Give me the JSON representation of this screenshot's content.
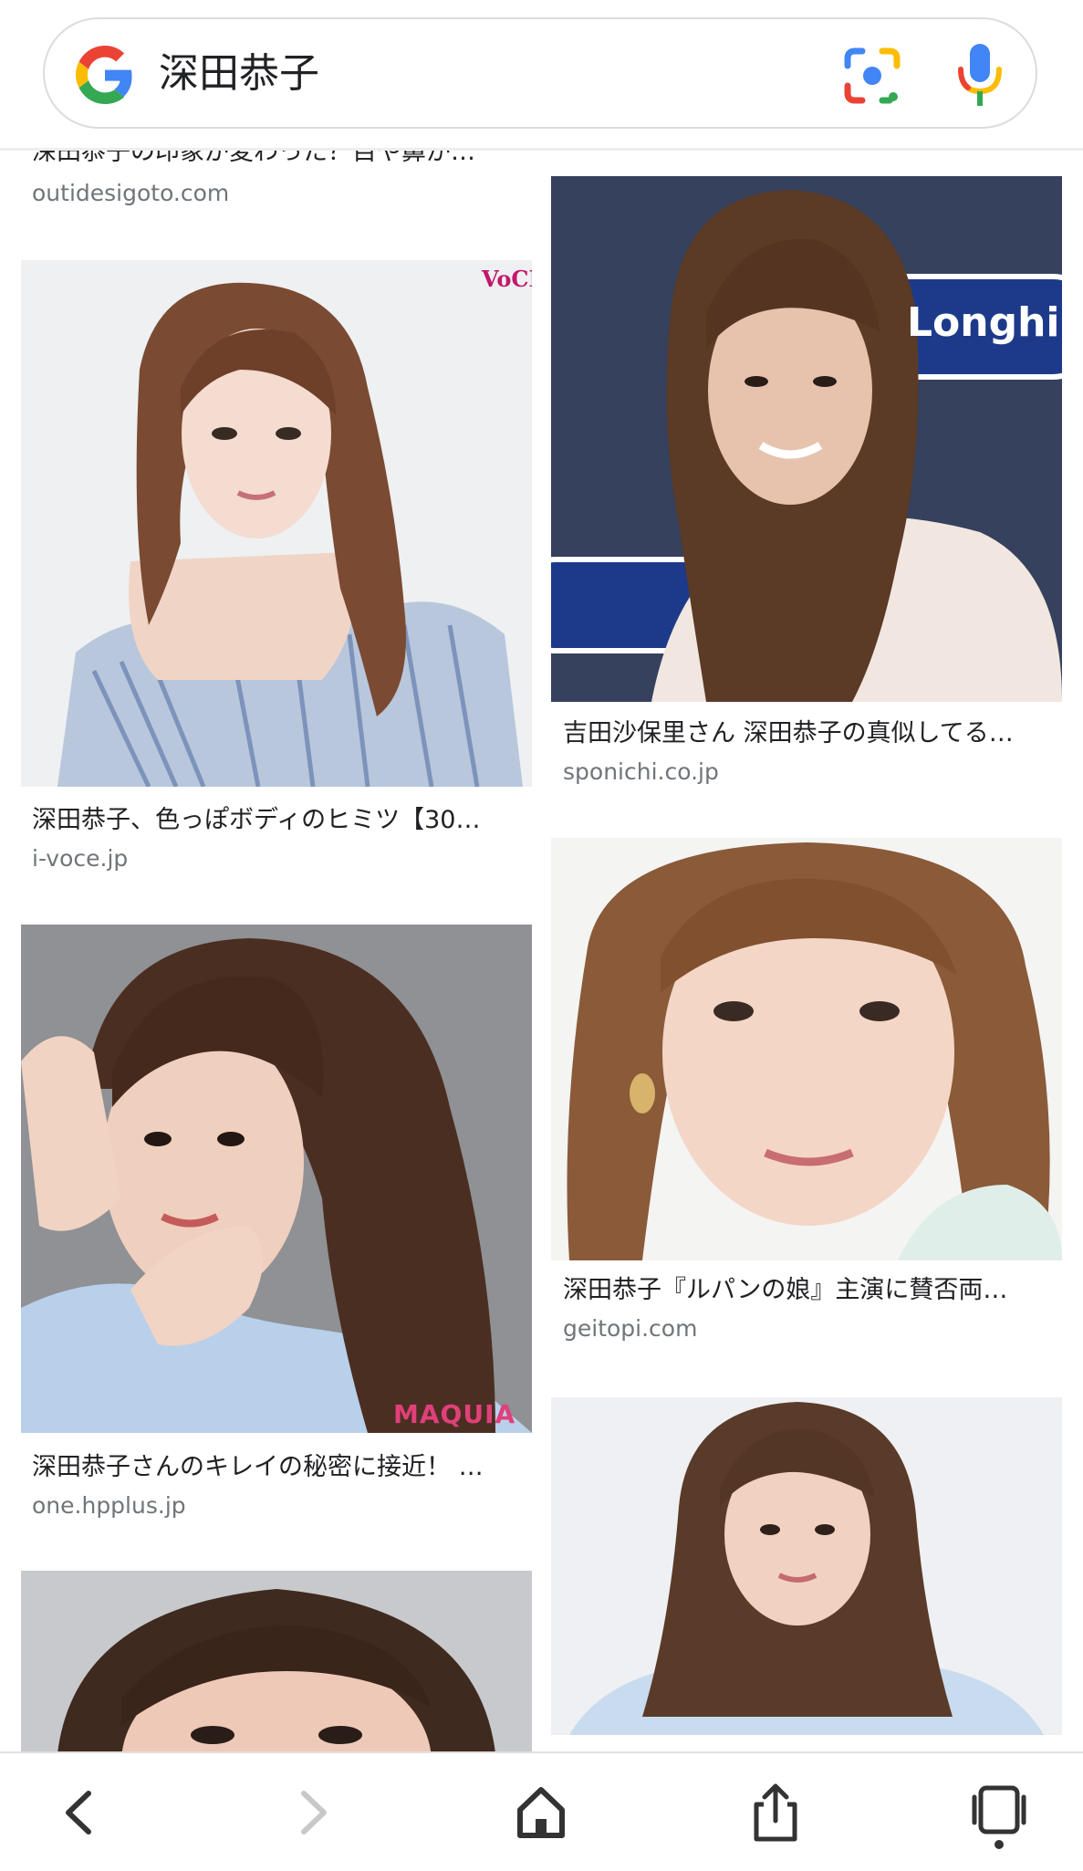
{
  "search": {
    "query": "深田恭子"
  },
  "results": [
    {
      "caption": "深田恭子の印象が変わった？目や鼻が…",
      "source": "outidesigoto.com"
    },
    {
      "caption": "深田恭子、色っぽボディのヒミツ【30…",
      "source": "i-voce.jp",
      "watermark": "VoCE"
    },
    {
      "caption": "吉田沙保里さん 深田恭子の真似してる…",
      "source": "sponichi.co.jp",
      "watermark": "Longhi"
    },
    {
      "caption": "深田恭子さんのキレイの秘密に接近！ …",
      "source": "one.hpplus.jp",
      "watermark": "MAQUIA"
    },
    {
      "caption": "深田恭子『ルパンの娘』主演に賛否両…",
      "source": "geitopi.com"
    }
  ],
  "navigation": {
    "back": "chevron-left-icon",
    "forward": "chevron-right-icon",
    "home": "home-icon",
    "share": "share-icon",
    "tabs": "tabs-icon"
  },
  "colors": {
    "google_blue": "#4285F4",
    "google_red": "#EA4335",
    "google_yellow": "#FBBC05",
    "google_green": "#34A853",
    "text_primary": "#202124",
    "text_secondary": "#70757a"
  }
}
